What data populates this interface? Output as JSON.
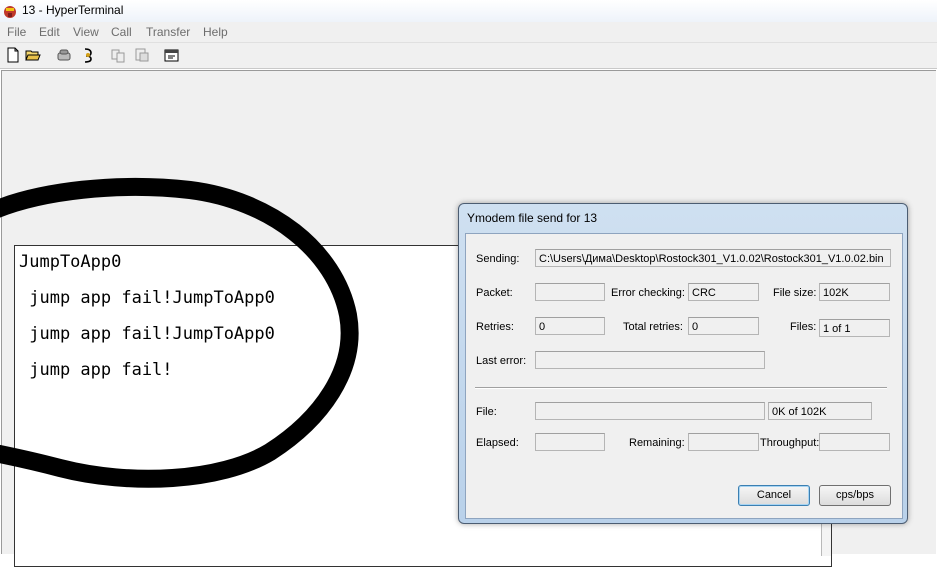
{
  "window": {
    "title": "13 - HyperTerminal",
    "app_icon": "hyperterminal-icon"
  },
  "menu": {
    "items": [
      "File",
      "Edit",
      "View",
      "Call",
      "Transfer",
      "Help"
    ]
  },
  "toolbar": {
    "icons": [
      "new-document-icon",
      "open-folder-icon",
      "call-icon",
      "disconnect-icon",
      "send-icon",
      "receive-icon",
      "properties-icon"
    ]
  },
  "terminal": {
    "lines": [
      "JumpToApp0",
      " jump app fail!JumpToApp0",
      " jump app fail!JumpToApp0",
      " jump app fail!"
    ]
  },
  "dialog": {
    "title": "Ymodem file send for 13",
    "sending_label": "Sending:",
    "sending_value": "C:\\Users\\Дима\\Desktop\\Rostock301_V1.0.02\\Rostock301_V1.0.02.bin",
    "packet_label": "Packet:",
    "packet_value": "",
    "error_checking_label": "Error checking:",
    "error_checking_value": "CRC",
    "file_size_label": "File size:",
    "file_size_value": "102K",
    "retries_label": "Retries:",
    "retries_value": "0",
    "total_retries_label": "Total retries:",
    "total_retries_value": "0",
    "files_label": "Files:",
    "files_value": "1 of 1",
    "last_error_label": "Last error:",
    "last_error_value": "",
    "file_label": "File:",
    "file_progress": 0,
    "file_progress_text": "0K of 102K",
    "elapsed_label": "Elapsed:",
    "elapsed_value": "",
    "remaining_label": "Remaining:",
    "remaining_value": "",
    "throughput_label": "Throughput:",
    "throughput_value": "",
    "cancel_label": "Cancel",
    "cps_label": "cps/bps"
  }
}
